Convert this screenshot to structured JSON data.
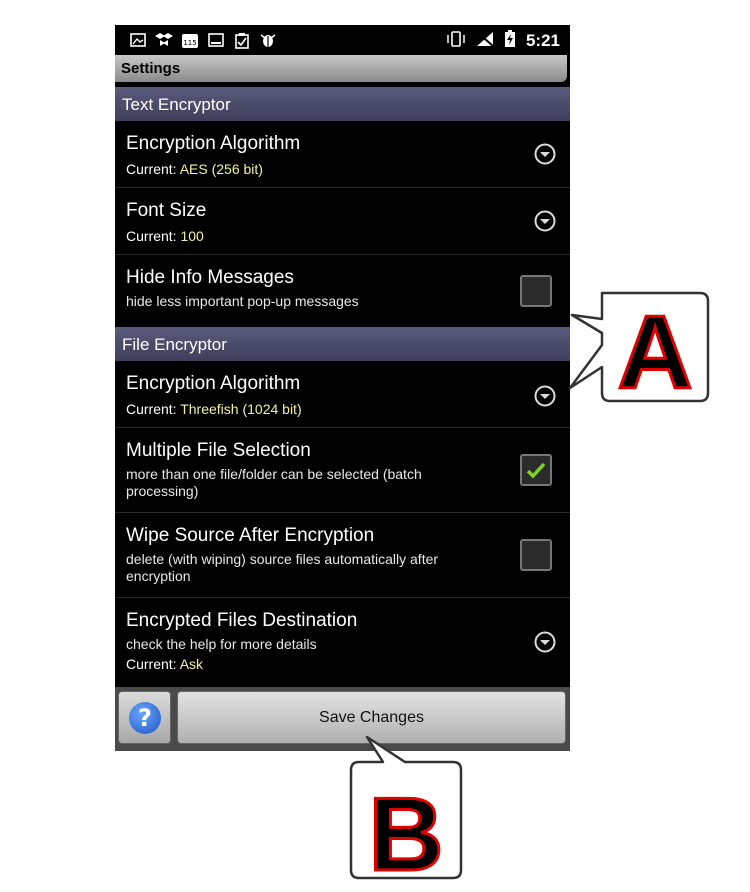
{
  "statusbar": {
    "icons": [
      "image-icon",
      "dropbox-icon",
      "calendar-icon",
      "photo-icon",
      "clipboard-icon",
      "bug-icon"
    ],
    "calendar_day": "115",
    "time": "5:21"
  },
  "titlebar": {
    "title": "Settings"
  },
  "text_encryptor": {
    "header": "Text Encryptor",
    "encryption_algorithm": {
      "title": "Encryption Algorithm",
      "current_label": "Current: ",
      "current_value": "AES (256 bit)"
    },
    "font_size": {
      "title": "Font Size",
      "current_label": "Current: ",
      "current_value": "100"
    },
    "hide_info": {
      "title": "Hide Info Messages",
      "description": "hide less important pop-up messages",
      "checked": false
    }
  },
  "file_encryptor": {
    "header": "File Encryptor",
    "encryption_algorithm": {
      "title": "Encryption Algorithm",
      "current_label": "Current: ",
      "current_value": "Threefish (1024 bit)"
    },
    "multiple_selection": {
      "title": "Multiple File Selection",
      "description": "more than one file/folder can be selected (batch processing)",
      "checked": true
    },
    "wipe_source": {
      "title": "Wipe Source After Encryption",
      "description": "delete (with wiping) source files automatically after encryption",
      "checked": false
    },
    "destination": {
      "title": "Encrypted Files Destination",
      "description": "check the help for more details",
      "current_label": "Current: ",
      "current_value": "Ask"
    }
  },
  "bottom": {
    "help_glyph": "?",
    "save_label": "Save Changes"
  },
  "callouts": {
    "a": "A",
    "b": "B"
  },
  "colors": {
    "accent_value": "#f2f2a0",
    "section_bg": "#4a4a6a",
    "checkmark": "#7ed321",
    "callout_letter": "#000000",
    "callout_outline": "#e00000"
  }
}
